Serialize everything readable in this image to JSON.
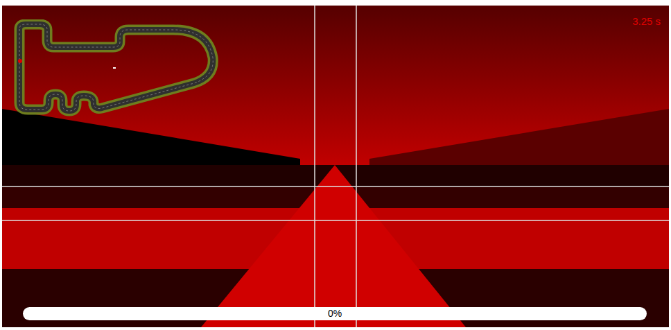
{
  "game": {
    "timer": "3.25 s",
    "progress": {
      "label": "0%",
      "level": 0
    }
  }
}
